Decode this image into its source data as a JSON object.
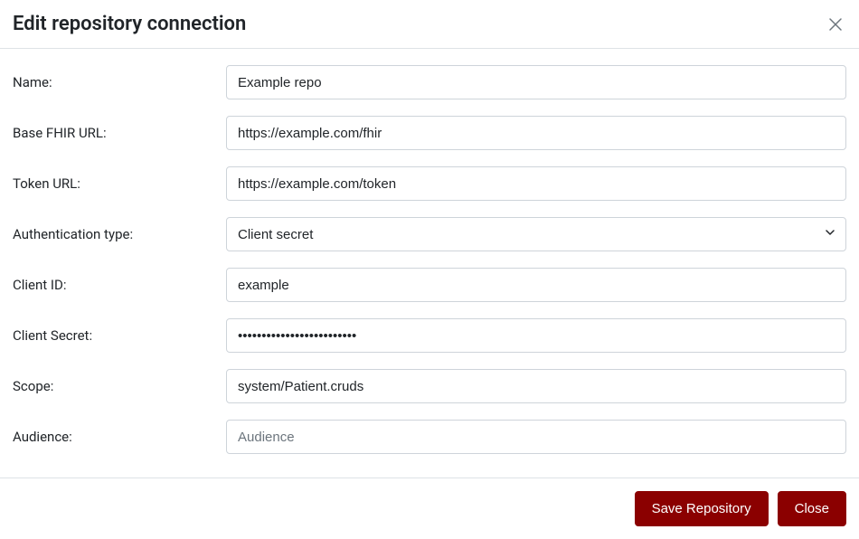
{
  "modal": {
    "title": "Edit repository connection"
  },
  "fields": {
    "name": {
      "label": "Name:",
      "value": "Example repo",
      "placeholder": ""
    },
    "baseUrl": {
      "label": "Base FHIR URL:",
      "value": "https://example.com/fhir",
      "placeholder": ""
    },
    "tokenUrl": {
      "label": "Token URL:",
      "value": "https://example.com/token",
      "placeholder": ""
    },
    "authType": {
      "label": "Authentication type:",
      "value": "Client secret"
    },
    "clientId": {
      "label": "Client ID:",
      "value": "example",
      "placeholder": ""
    },
    "clientSecret": {
      "label": "Client Secret:",
      "value": "•••••••••••••••••••••••••",
      "placeholder": ""
    },
    "scope": {
      "label": "Scope:",
      "value": "system/Patient.cruds",
      "placeholder": ""
    },
    "audience": {
      "label": "Audience:",
      "value": "",
      "placeholder": "Audience"
    }
  },
  "buttons": {
    "save": "Save Repository",
    "close": "Close"
  }
}
